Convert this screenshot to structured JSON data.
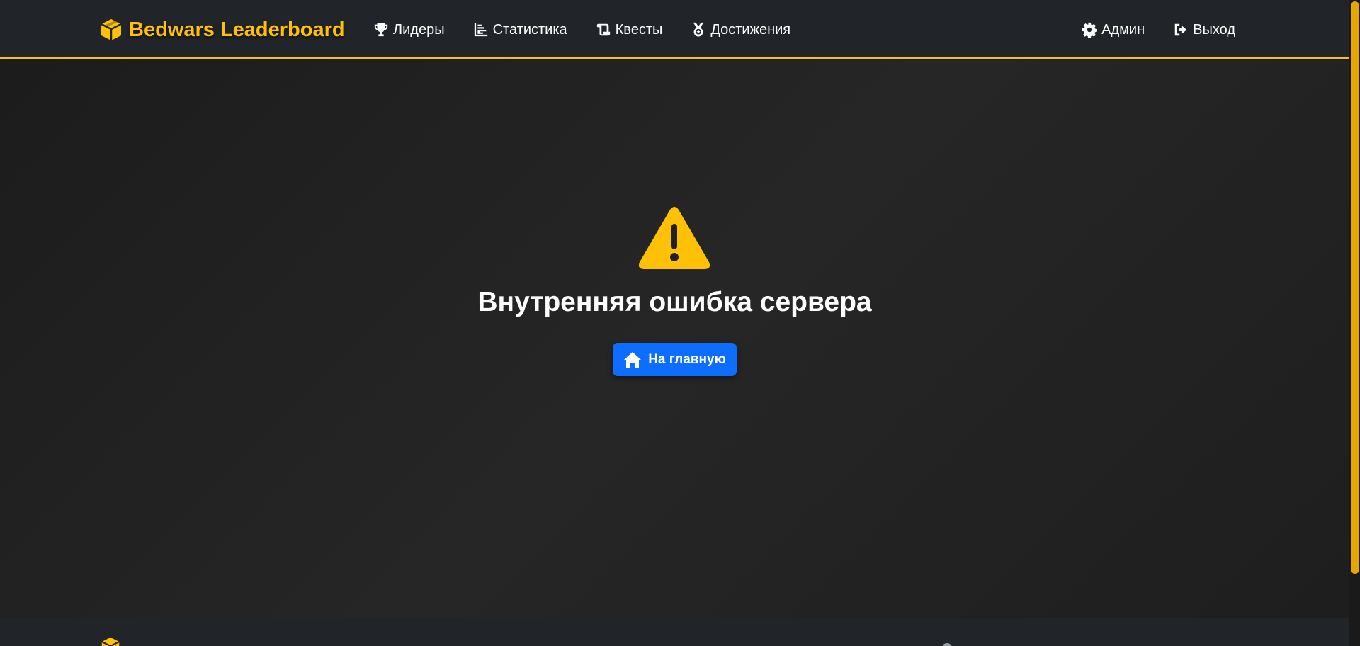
{
  "navbar": {
    "brand": "Bedwars Leaderboard",
    "brand_icon": "cube-icon",
    "left_links": [
      {
        "label": "Лидеры",
        "icon": "trophy-icon"
      },
      {
        "label": "Статистика",
        "icon": "chart-icon"
      },
      {
        "label": "Квесты",
        "icon": "scroll-icon"
      },
      {
        "label": "Достижения",
        "icon": "medal-icon"
      }
    ],
    "right_links": [
      {
        "label": "Админ",
        "icon": "gear-icon"
      },
      {
        "label": "Выход",
        "icon": "sign-out-icon"
      }
    ]
  },
  "error": {
    "icon": "warning-triangle-icon",
    "title": "Внутренняя ошибка сервера",
    "button_label": "На главную",
    "button_icon": "home-icon"
  },
  "colors": {
    "accent": "#ffc107",
    "primary_button": "#0d6efd",
    "navbar_bg": "#212529",
    "page_bg": "#212121"
  }
}
